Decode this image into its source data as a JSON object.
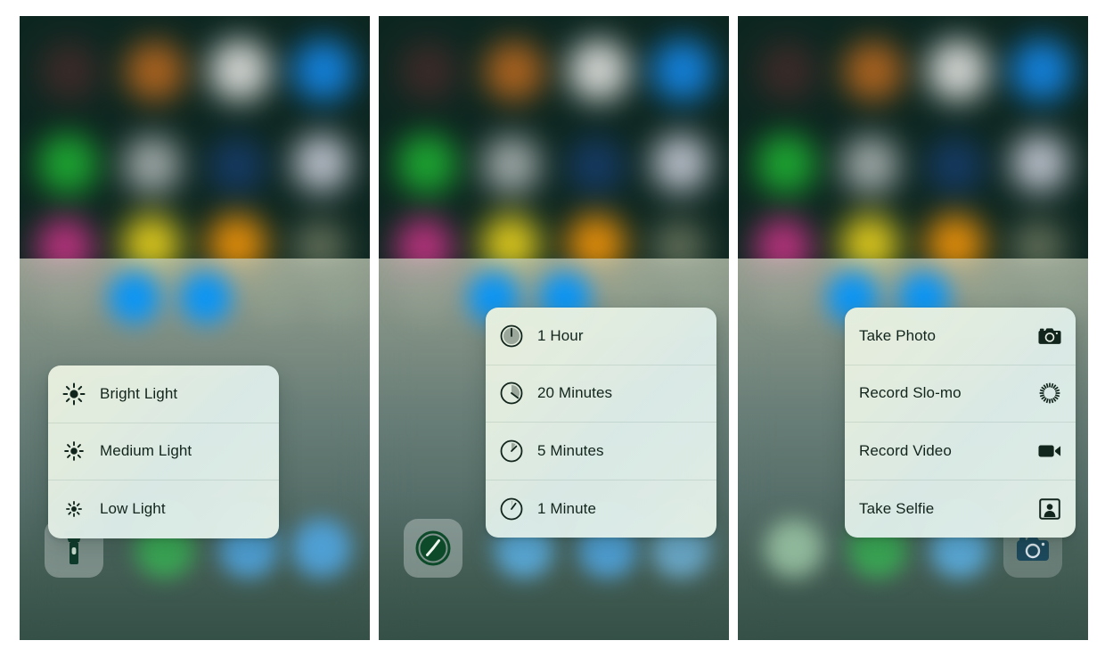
{
  "screen": {
    "platform": "ios-control-center",
    "panel_count": 3,
    "background_description": "blurred iOS home screen with control center sheet"
  },
  "colors": {
    "menu_text": "#12251c",
    "icon_dark": "#12251c",
    "toggle_blue": "#0a95f5",
    "timer_active_green": "#0d4a2a",
    "camera_icon": "#1d4a5e",
    "flashlight_icon": "#0f3b2c",
    "menu_bg": "#e5efe2"
  },
  "panels": [
    {
      "id": "flashlight-panel",
      "shortcut": {
        "name": "flashlight",
        "icon": "flashlight-icon",
        "active": true,
        "position_index": 0
      },
      "menu": {
        "name": "flashlight-quick-actions",
        "icon_side": "left",
        "items": [
          {
            "label": "Bright Light",
            "icon": "sun-bright-icon",
            "icon_scale": 1.0
          },
          {
            "label": "Medium Light",
            "icon": "sun-medium-icon",
            "icon_scale": 0.86
          },
          {
            "label": "Low Light",
            "icon": "sun-low-icon",
            "icon_scale": 0.7
          }
        ]
      }
    },
    {
      "id": "timer-panel",
      "shortcut": {
        "name": "timer",
        "icon": "timer-icon",
        "active": true,
        "position_index": 0
      },
      "menu": {
        "name": "timer-quick-actions",
        "icon_side": "left",
        "items": [
          {
            "label": "1 Hour",
            "icon": "timer-dial-full-icon",
            "fill_deg": 360
          },
          {
            "label": "20 Minutes",
            "icon": "timer-dial-120-icon",
            "fill_deg": 120
          },
          {
            "label": "5 Minutes",
            "icon": "timer-dial-30-icon",
            "fill_deg": 30
          },
          {
            "label": "1 Minute",
            "icon": "timer-dial-6-icon",
            "fill_deg": 6
          }
        ]
      }
    },
    {
      "id": "camera-panel",
      "shortcut": {
        "name": "camera",
        "icon": "camera-icon",
        "active": true,
        "position_index": 3
      },
      "menu": {
        "name": "camera-quick-actions",
        "icon_side": "right",
        "items": [
          {
            "label": "Take Photo",
            "icon": "camera-icon"
          },
          {
            "label": "Record Slo-mo",
            "icon": "slomo-icon"
          },
          {
            "label": "Record Video",
            "icon": "video-camera-icon"
          },
          {
            "label": "Take Selfie",
            "icon": "selfie-portrait-icon"
          }
        ]
      }
    }
  ]
}
